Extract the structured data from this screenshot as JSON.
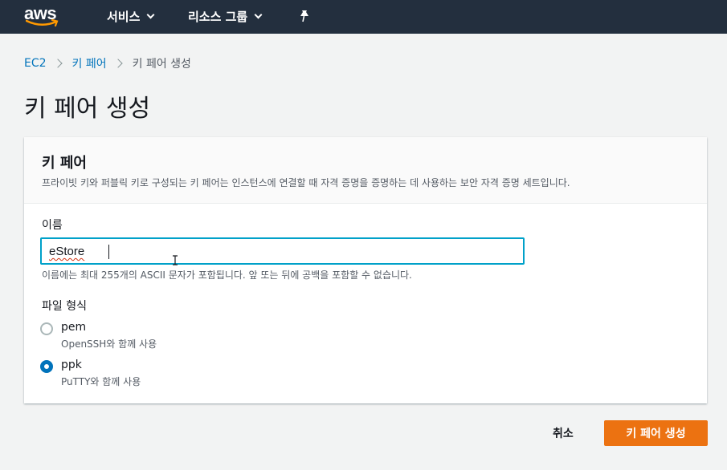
{
  "topnav": {
    "logo_text": "aws",
    "services_label": "서비스",
    "resource_groups_label": "리소스 그룹"
  },
  "breadcrumb": {
    "items": [
      "EC2",
      "키 페어",
      "키 페어 생성"
    ]
  },
  "page": {
    "title": "키 페어 생성"
  },
  "panel": {
    "title": "키 페어",
    "description": "프라이빗 키와 퍼블릭 키로 구성되는 키 페어는 인스턴스에 연결할 때 자격 증명을 증명하는 데 사용하는 보안 자격 증명 세트입니다.",
    "name_label": "이름",
    "name_value": "eStore",
    "name_hint": "이름에는 최대 255개의 ASCII 문자가 포함됩니다. 앞 또는 뒤에 공백을 포함할 수 없습니다.",
    "format_label": "파일 형식",
    "formats": [
      {
        "label": "pem",
        "description": "OpenSSH와 함께 사용",
        "selected": false
      },
      {
        "label": "ppk",
        "description": "PuTTY와 함께 사용",
        "selected": true
      }
    ]
  },
  "actions": {
    "cancel_label": "취소",
    "create_label": "키 페어 생성"
  },
  "colors": {
    "nav_bg": "#232f3e",
    "link": "#0073bb",
    "primary_button": "#ec7211",
    "focus_border": "#00a1c9"
  }
}
